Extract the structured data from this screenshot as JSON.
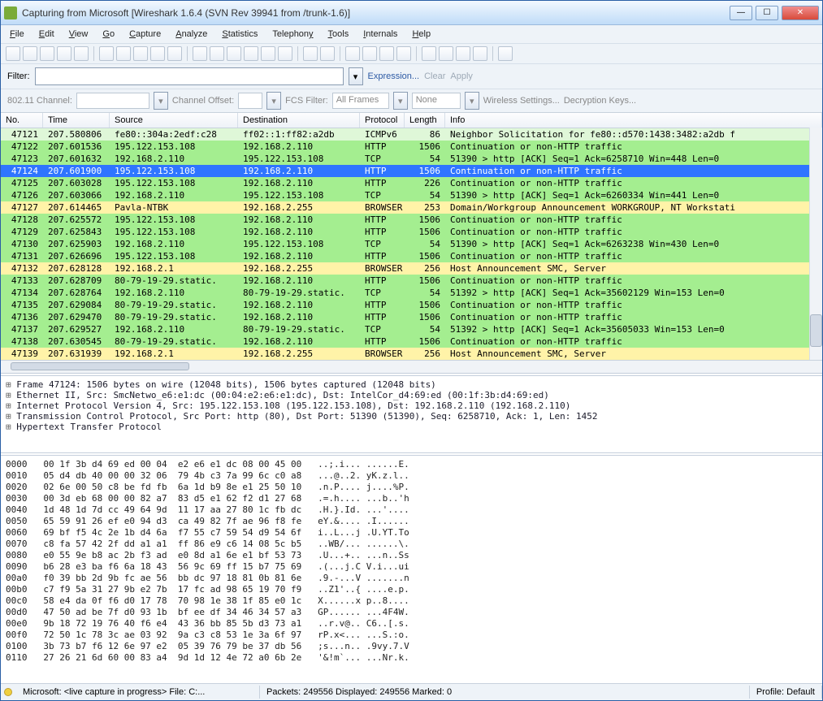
{
  "window": {
    "title": "Capturing from Microsoft   [Wireshark 1.6.4  (SVN Rev 39941 from /trunk-1.6)]"
  },
  "menu": {
    "file": "File",
    "edit": "Edit",
    "view": "View",
    "go": "Go",
    "capture": "Capture",
    "analyze": "Analyze",
    "statistics": "Statistics",
    "telephony": "Telephony",
    "tools": "Tools",
    "internals": "Internals",
    "help": "Help"
  },
  "filter": {
    "label": "Filter:",
    "value": "",
    "expression": "Expression...",
    "clear": "Clear",
    "apply": "Apply"
  },
  "wifi": {
    "channel_label": "802.11 Channel:",
    "offset_label": "Channel Offset:",
    "fcs_label": "FCS Filter:",
    "fcs_value": "All Frames",
    "none": "None",
    "settings": "Wireless Settings...",
    "keys": "Decryption Keys..."
  },
  "columns": {
    "no": "No.",
    "time": "Time",
    "src": "Source",
    "dst": "Destination",
    "proto": "Protocol",
    "len": "Length",
    "info": "Info"
  },
  "packets": [
    {
      "no": "47121",
      "time": "207.580806",
      "src": "fe80::304a:2edf:c28",
      "dst": "ff02::1:ff82:a2db",
      "proto": "ICMPv6",
      "len": "86",
      "info": "Neighbor Solicitation for fe80::d570:1438:3482:a2db f",
      "cls": "lightgreen"
    },
    {
      "no": "47122",
      "time": "207.601536",
      "src": "195.122.153.108",
      "dst": "192.168.2.110",
      "proto": "HTTP",
      "len": "1506",
      "info": "Continuation or non-HTTP traffic",
      "cls": "green"
    },
    {
      "no": "47123",
      "time": "207.601632",
      "src": "192.168.2.110",
      "dst": "195.122.153.108",
      "proto": "TCP",
      "len": "54",
      "info": "51390 > http [ACK] Seq=1 Ack=6258710 Win=448 Len=0",
      "cls": "green"
    },
    {
      "no": "47124",
      "time": "207.601900",
      "src": "195.122.153.108",
      "dst": "192.168.2.110",
      "proto": "HTTP",
      "len": "1506",
      "info": "Continuation or non-HTTP traffic",
      "cls": "blue"
    },
    {
      "no": "47125",
      "time": "207.603028",
      "src": "195.122.153.108",
      "dst": "192.168.2.110",
      "proto": "HTTP",
      "len": "226",
      "info": "Continuation or non-HTTP traffic",
      "cls": "green"
    },
    {
      "no": "47126",
      "time": "207.603066",
      "src": "192.168.2.110",
      "dst": "195.122.153.108",
      "proto": "TCP",
      "len": "54",
      "info": "51390 > http [ACK] Seq=1 Ack=6260334 Win=441 Len=0",
      "cls": "green"
    },
    {
      "no": "47127",
      "time": "207.614465",
      "src": "Pavla-NTBK",
      "dst": "192.168.2.255",
      "proto": "BROWSER",
      "len": "253",
      "info": "Domain/Workgroup Announcement WORKGROUP, NT Workstati",
      "cls": "yellow"
    },
    {
      "no": "47128",
      "time": "207.625572",
      "src": "195.122.153.108",
      "dst": "192.168.2.110",
      "proto": "HTTP",
      "len": "1506",
      "info": "Continuation or non-HTTP traffic",
      "cls": "green"
    },
    {
      "no": "47129",
      "time": "207.625843",
      "src": "195.122.153.108",
      "dst": "192.168.2.110",
      "proto": "HTTP",
      "len": "1506",
      "info": "Continuation or non-HTTP traffic",
      "cls": "green"
    },
    {
      "no": "47130",
      "time": "207.625903",
      "src": "192.168.2.110",
      "dst": "195.122.153.108",
      "proto": "TCP",
      "len": "54",
      "info": "51390 > http [ACK] Seq=1 Ack=6263238 Win=430 Len=0",
      "cls": "green"
    },
    {
      "no": "47131",
      "time": "207.626696",
      "src": "195.122.153.108",
      "dst": "192.168.2.110",
      "proto": "HTTP",
      "len": "1506",
      "info": "Continuation or non-HTTP traffic",
      "cls": "green"
    },
    {
      "no": "47132",
      "time": "207.628128",
      "src": "192.168.2.1",
      "dst": "192.168.2.255",
      "proto": "BROWSER",
      "len": "256",
      "info": "Host Announcement SMC, Server",
      "cls": "yellow"
    },
    {
      "no": "47133",
      "time": "207.628709",
      "src": "80-79-19-29.static.",
      "dst": "192.168.2.110",
      "proto": "HTTP",
      "len": "1506",
      "info": "Continuation or non-HTTP traffic",
      "cls": "green"
    },
    {
      "no": "47134",
      "time": "207.628764",
      "src": "192.168.2.110",
      "dst": "80-79-19-29.static.",
      "proto": "TCP",
      "len": "54",
      "info": "51392 > http [ACK] Seq=1 Ack=35602129 Win=153 Len=0",
      "cls": "green"
    },
    {
      "no": "47135",
      "time": "207.629084",
      "src": "80-79-19-29.static.",
      "dst": "192.168.2.110",
      "proto": "HTTP",
      "len": "1506",
      "info": "Continuation or non-HTTP traffic",
      "cls": "green"
    },
    {
      "no": "47136",
      "time": "207.629470",
      "src": "80-79-19-29.static.",
      "dst": "192.168.2.110",
      "proto": "HTTP",
      "len": "1506",
      "info": "Continuation or non-HTTP traffic",
      "cls": "green"
    },
    {
      "no": "47137",
      "time": "207.629527",
      "src": "192.168.2.110",
      "dst": "80-79-19-29.static.",
      "proto": "TCP",
      "len": "54",
      "info": "51392 > http [ACK] Seq=1 Ack=35605033 Win=153 Len=0",
      "cls": "green"
    },
    {
      "no": "47138",
      "time": "207.630545",
      "src": "80-79-19-29.static.",
      "dst": "192.168.2.110",
      "proto": "HTTP",
      "len": "1506",
      "info": "Continuation or non-HTTP traffic",
      "cls": "green"
    },
    {
      "no": "47139",
      "time": "207.631939",
      "src": "192.168.2.1",
      "dst": "192.168.2.255",
      "proto": "BROWSER",
      "len": "256",
      "info": "Host Announcement SMC, Server",
      "cls": "yellow"
    }
  ],
  "details": [
    "Frame 47124: 1506 bytes on wire (12048 bits), 1506 bytes captured (12048 bits)",
    "Ethernet II, Src: SmcNetwo_e6:e1:dc (00:04:e2:e6:e1:dc), Dst: IntelCor_d4:69:ed (00:1f:3b:d4:69:ed)",
    "Internet Protocol Version 4, Src: 195.122.153.108 (195.122.153.108), Dst: 192.168.2.110 (192.168.2.110)",
    "Transmission Control Protocol, Src Port: http (80), Dst Port: 51390 (51390), Seq: 6258710, Ack: 1, Len: 1452",
    "Hypertext Transfer Protocol"
  ],
  "hex": "0000   00 1f 3b d4 69 ed 00 04  e2 e6 e1 dc 08 00 45 00   ..;.i... ......E.\n0010   05 d4 db 40 00 00 32 06  79 4b c3 7a 99 6c c0 a8   ...@..2. yK.z.l..\n0020   02 6e 00 50 c8 be fd fb  6a 1d b9 8e e1 25 50 10   .n.P.... j....%P.\n0030   00 3d eb 68 00 00 82 a7  83 d5 e1 62 f2 d1 27 68   .=.h.... ...b..'h\n0040   1d 48 1d 7d cc 49 64 9d  11 17 aa 27 80 1c fb dc   .H.}.Id. ...'....\n0050   65 59 91 26 ef e0 94 d3  ca 49 82 7f ae 96 f8 fe   eY.&.... .I......\n0060   69 bf f5 4c 2e 1b d4 6a  f7 55 c7 59 54 d9 54 6f   i..L...j .U.YT.To\n0070   c8 fa 57 42 2f dd a1 a1  ff 86 e9 c6 14 08 5c b5   ..WB/... ......\\.\n0080   e0 55 9e b8 ac 2b f3 ad  e0 8d a1 6e e1 bf 53 73   .U...+.. ...n..Ss\n0090   b6 28 e3 ba f6 6a 18 43  56 9c 69 ff 15 b7 75 69   .(...j.C V.i...ui\n00a0   f0 39 bb 2d 9b fc ae 56  bb dc 97 18 81 0b 81 6e   .9.-...V .......n\n00b0   c7 f9 5a 31 27 9b e2 7b  17 fc ad 98 65 19 70 f9   ..Z1'..{ ....e.p.\n00c0   58 e4 da 0f f6 d0 17 78  70 98 1e 38 1f 85 e0 1c   X......x p..8....\n00d0   47 50 ad be 7f d0 93 1b  bf ee df 34 46 34 57 a3   GP...... ...4F4W.\n00e0   9b 18 72 19 76 40 f6 e4  43 36 bb 85 5b d3 73 a1   ..r.v@.. C6..[.s.\n00f0   72 50 1c 78 3c ae 03 92  9a c3 c8 53 1e 3a 6f 97   rP.x<... ...S.:o.\n0100   3b 73 b7 f6 12 6e 97 e2  05 39 76 79 be 37 db 56   ;s...n.. .9vy.7.V\n0110   27 26 21 6d 60 00 83 a4  9d 1d 12 4e 72 a0 6b 2e   '&!m`... ...Nr.k.",
  "status": {
    "src": "Microsoft: <live capture in progress> File: C:...",
    "counts": "Packets: 249556 Displayed: 249556 Marked: 0",
    "profile": "Profile: Default"
  }
}
